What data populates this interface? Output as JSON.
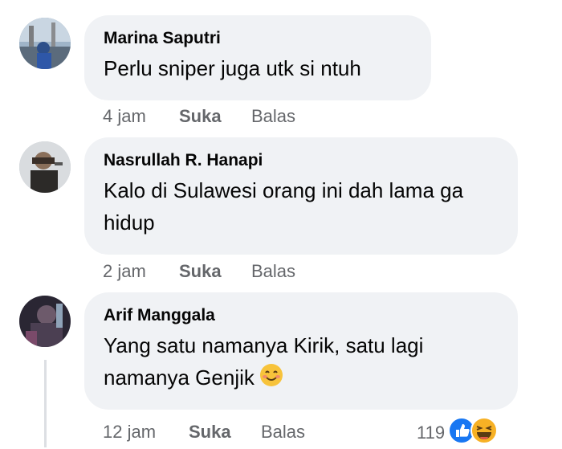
{
  "comments": [
    {
      "author": "Marina Saputri",
      "text": "Perlu sniper juga utk si ntuh",
      "time": "4 jam",
      "like_label": "Suka",
      "reply_label": "Balas"
    },
    {
      "author": "Nasrullah R. Hanapi",
      "text": "Kalo di Sulawesi orang ini dah lama ga hidup",
      "time": "2 jam",
      "like_label": "Suka",
      "reply_label": "Balas"
    },
    {
      "author": "Arif Manggala",
      "text": "Yang satu namanya Kirik, satu lagi namanya Genjik",
      "time": "12 jam",
      "like_label": "Suka",
      "reply_label": "Balas",
      "reaction_count": "119",
      "reactions": [
        "like-icon",
        "haha-icon"
      ]
    }
  ],
  "colors": {
    "bubble": "#f0f2f5",
    "meta_text": "#65676b",
    "like_blue": "#1877f2",
    "haha_yellow": "#f7b125"
  }
}
